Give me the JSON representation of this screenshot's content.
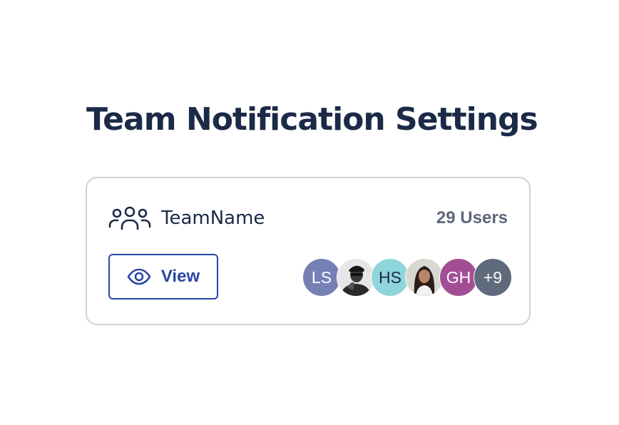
{
  "page": {
    "title": "Team Notification Settings"
  },
  "team": {
    "icon": "users-icon",
    "name": "TeamName",
    "user_count_label": "29 Users"
  },
  "view_button": {
    "icon": "eye-icon",
    "label": "View"
  },
  "avatars": [
    {
      "initials": "LS",
      "color": "#7580b5",
      "text_color": "#ffffff"
    },
    {
      "photo": true,
      "description_icon": "user-photo-icon"
    },
    {
      "initials": "HS",
      "color": "#8fd5dc",
      "text_color": "#1b2a47"
    },
    {
      "photo": true,
      "description_icon": "user-photo-icon"
    },
    {
      "initials": "GH",
      "color": "#a24e95",
      "text_color": "#ffffff"
    },
    {
      "initials": "+9",
      "color": "#5f6a7d",
      "text_color": "#ffffff"
    }
  ],
  "colors": {
    "heading": "#1b2a47",
    "accent": "#2a46a4",
    "muted": "#5d6678",
    "border": "#cfd1d6"
  }
}
